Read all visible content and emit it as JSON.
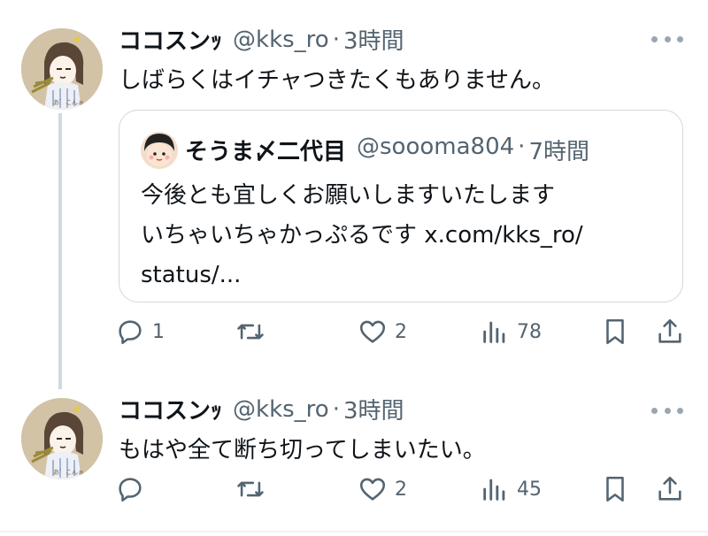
{
  "tweets": [
    {
      "author_name": "ココスンｯ",
      "handle": "@kks_ro",
      "time": "3時間",
      "text": "しばらくはイチャつきたくもありません。",
      "quote": {
        "author_name": "そうま〆二代目",
        "handle": "@soooma804",
        "time": "7時間",
        "lines": [
          "今後とも宜しくお願いしますいたします",
          "いちゃいちゃかっぷるです x.com/kks_ro/",
          "status/..."
        ]
      },
      "stats": {
        "replies": "1",
        "reposts": "",
        "likes": "2",
        "views": "78"
      }
    },
    {
      "author_name": "ココスンｯ",
      "handle": "@kks_ro",
      "time": "3時間",
      "text": "もはや全て断ち切ってしまいたい。",
      "stats": {
        "replies": "",
        "reposts": "",
        "likes": "2",
        "views": "45"
      }
    }
  ],
  "separator": "·",
  "icons": [
    "more-icon",
    "reply-icon",
    "repost-icon",
    "like-icon",
    "views-icon",
    "bookmark-icon",
    "share-icon"
  ],
  "colors": {
    "text": "#0f1419",
    "secondary": "#536471",
    "border": "#cfd9de",
    "thread_line": "#cfd9de"
  }
}
